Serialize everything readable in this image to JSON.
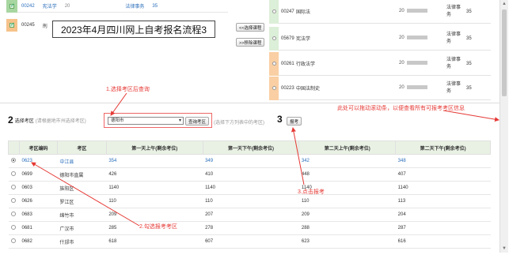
{
  "top_list": {
    "rows": [
      {
        "code": "00242",
        "name": "宪法学",
        "date": "20",
        "type": "法律事务",
        "credit": "35"
      },
      {
        "code": "00245",
        "name": "刑",
        "date": "",
        "type": "",
        "credit": ""
      }
    ]
  },
  "title_box": "2023年4月四川网上自考报名流程3",
  "buttons": {
    "select_course": "<<选择课程",
    "remove_course": ">>移除课程",
    "query_region": "查询考区",
    "register": "报考"
  },
  "courses": [
    {
      "code": "00247",
      "name": "国际法",
      "date": "20",
      "type": "法律事务",
      "credit": "35"
    },
    {
      "code": "05679",
      "name": "宪法学",
      "date": "20",
      "type": "法律事务",
      "credit": "35"
    },
    {
      "code": "00261",
      "name": "行政法学",
      "date": "20",
      "type": "法律事务",
      "credit": "35"
    },
    {
      "code": "00223",
      "name": "中国法制史",
      "date": "20",
      "type": "法律事务",
      "credit": "35"
    }
  ],
  "step2": {
    "number": "2",
    "label": "选择考区",
    "hint": "(请根据地市州选择考区)",
    "selected_city": "德阳市",
    "hint2": "(选择下方列表中的考区)"
  },
  "step3": {
    "number": "3"
  },
  "table": {
    "headers": [
      "考区编码",
      "考区",
      "第一天上午(剩余考位)",
      "第一天下午(剩余考位)",
      "第二天上午(剩余考位)",
      "第二天下午(剩余考位)"
    ],
    "rows": [
      {
        "code": "0623",
        "name": "中江县",
        "d1am": "354",
        "d1pm": "349",
        "d2am": "342",
        "d2pm": "348",
        "selected": true
      },
      {
        "code": "0699",
        "name": "德阳市直属",
        "d1am": "426",
        "d1pm": "410",
        "d2am": "448",
        "d2pm": "407",
        "selected": false
      },
      {
        "code": "0603",
        "name": "旌阳区",
        "d1am": "1140",
        "d1pm": "1140",
        "d2am": "1140",
        "d2pm": "1140",
        "selected": false
      },
      {
        "code": "0626",
        "name": "罗江区",
        "d1am": "110",
        "d1pm": "110",
        "d2am": "110",
        "d2pm": "113",
        "selected": false
      },
      {
        "code": "0683",
        "name": "绵竹市",
        "d1am": "209",
        "d1pm": "207",
        "d2am": "209",
        "d2pm": "204",
        "selected": false
      },
      {
        "code": "0681",
        "name": "广汉市",
        "d1am": "285",
        "d1pm": "278",
        "d2am": "288",
        "d2pm": "287",
        "selected": false
      },
      {
        "code": "0682",
        "name": "什邡市",
        "d1am": "618",
        "d1pm": "607",
        "d2am": "623",
        "d2pm": "616",
        "selected": false
      }
    ]
  },
  "annotations": {
    "a1": "1.选择考区后查询",
    "a2": "2.勾选报考考区",
    "a3": "3.点击报考",
    "scroll_tip": "此处可以拖动滚动条，以便查看所有可报考考区信息"
  },
  "colors": {
    "annotation": "#e53935",
    "link": "#2a6ebb",
    "header_bg": "#e9f1e4"
  }
}
